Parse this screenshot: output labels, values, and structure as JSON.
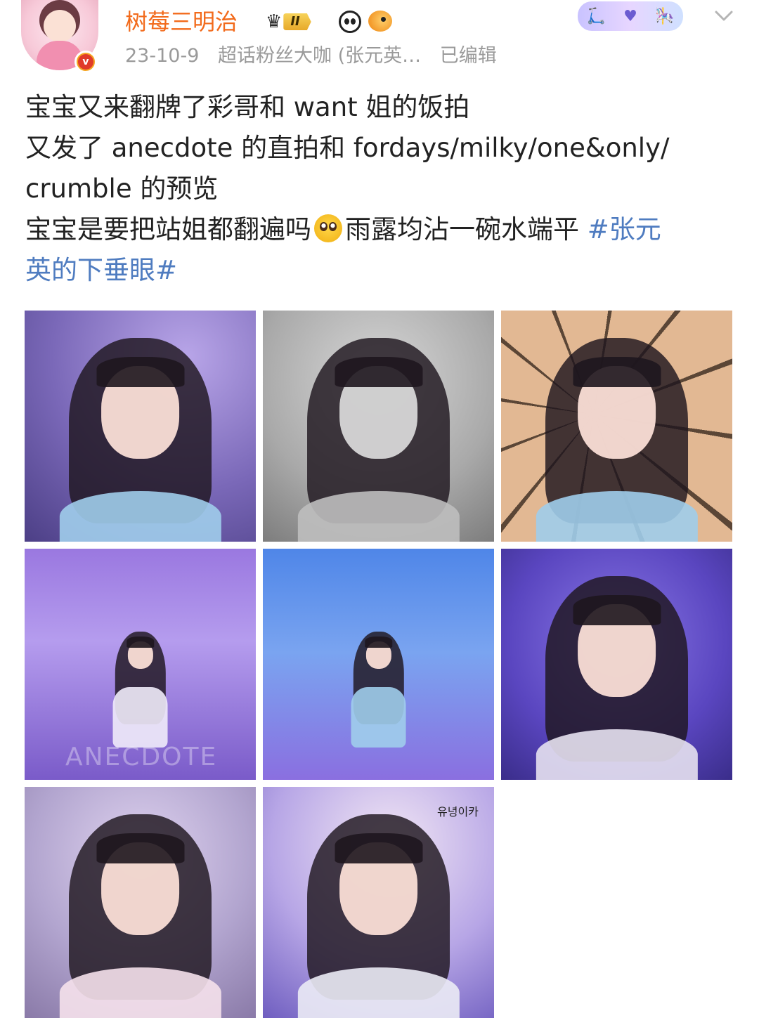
{
  "user": {
    "name": "树莓三明治",
    "level_badge": "II",
    "avatar_verified_mark": "v"
  },
  "post": {
    "date": "23-10-9",
    "source": "超话粉丝大咖 (张元英…",
    "edited": "已编辑",
    "text_lines": [
      "宝宝又来翻牌了彩哥和 want 姐的饭拍",
      "又发了 anecdote 的直拍和 fordays/milky/one&only/",
      "crumble 的预览"
    ],
    "line4_before_emoji": "宝宝是要把站姐都翻遍吗",
    "line4_after_emoji": "雨露均沾一碗水端平 ",
    "topic_part1": "#张元",
    "topic_part2": "英的下垂眼#"
  },
  "icons": {
    "crown": "crown-icon",
    "panda": "panda-icon",
    "fish": "fish-icon",
    "emoji": "pleading-face-emoji",
    "menu": "chevron-down-icon"
  },
  "photos": {
    "watermark_anecdote": "ANECDOTE",
    "watermark_handle": "유녕이카"
  },
  "colors": {
    "username": "#f26a1b",
    "topic": "#4f7cc0",
    "meta": "#9a9a9a"
  }
}
